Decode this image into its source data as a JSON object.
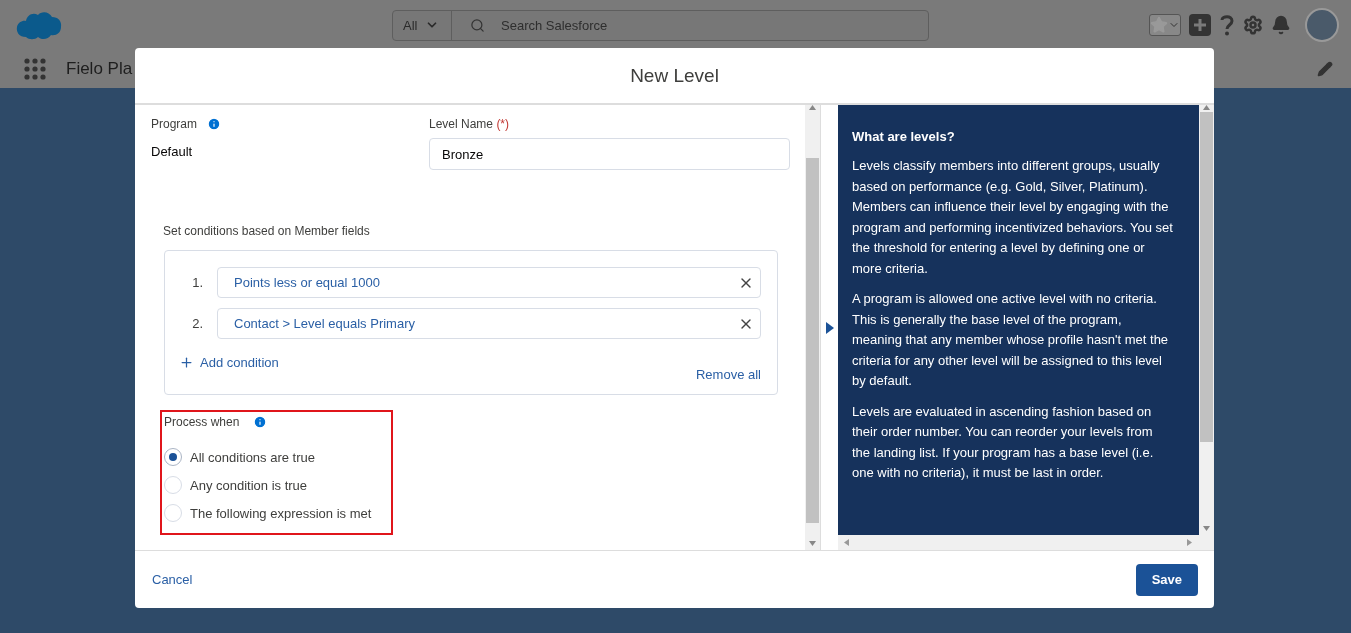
{
  "global_header": {
    "search_scope": "All",
    "search_placeholder": "Search Salesforce"
  },
  "app_nav": {
    "app_name": "Fielo Pla"
  },
  "modal": {
    "title": "New Level",
    "program": {
      "label": "Program",
      "value": "Default"
    },
    "level_name": {
      "label": "Level Name",
      "required_mark": "(*)",
      "value": "Bronze"
    },
    "conditions": {
      "label": "Set conditions based on Member fields",
      "items": [
        {
          "number": "1.",
          "text": "Points less or equal 1000"
        },
        {
          "number": "2.",
          "text": "Contact > Level equals Primary"
        }
      ],
      "add_label": "Add condition",
      "remove_all": "Remove all"
    },
    "process_when": {
      "label": "Process when",
      "options": [
        {
          "label": "All conditions are true",
          "selected": true
        },
        {
          "label": "Any condition is true",
          "selected": false
        },
        {
          "label": "The following expression is met",
          "selected": false
        }
      ]
    },
    "help": {
      "title": "What are levels?",
      "paragraphs": [
        "Levels classify members into different groups, usually based on performance (e.g. Gold, Silver, Platinum). Members can influence their level by engaging with the program and performing incentivized behaviors. You set the threshold for entering a level by defining one or more criteria.",
        "A program is allowed one active level with no criteria. This is generally the base level of the program, meaning that any member whose profile hasn't met the criteria for any other level will be assigned to this level by default.",
        "Levels are evaluated in ascending fashion based on their order number. You can reorder your levels from the landing list. If your program has a base level (i.e. one with no criteria), it must be last in order."
      ]
    },
    "footer": {
      "cancel": "Cancel",
      "save": "Save"
    }
  }
}
